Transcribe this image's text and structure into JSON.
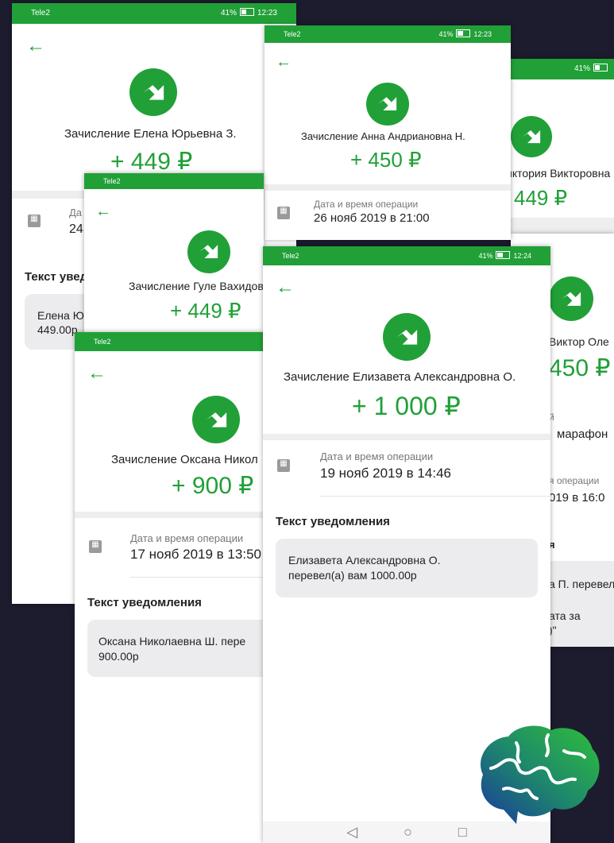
{
  "status": {
    "carrier": "Tele2",
    "battery": "41%",
    "times": [
      "12:23",
      "12:24"
    ]
  },
  "screens": {
    "s1": {
      "title": "Зачисление Елена Юрьевна З.",
      "amount": "+ 449 ₽",
      "date_label": "Да",
      "date_value": "24",
      "notif_title": "Текст увед",
      "notif_text": [
        "Елена Ю",
        "449.00р"
      ]
    },
    "s2": {
      "title": "Зачисление Анна Андриановна Н.",
      "amount": "+ 450 ₽",
      "date_label": "Дата и время операции",
      "date_value": "26 нояб 2019 в 21:00"
    },
    "s3": {
      "title": "иктория Викторовна",
      "amount": "449 ₽"
    },
    "s4": {
      "title": "Зачисление Гуле Вахидов",
      "amount": "+ 449 ₽"
    },
    "s5": {
      "title": "Зачисление Оксана Никол",
      "amount": "+ 900 ₽",
      "date_label": "Дата и время операции",
      "date_value": "17 нояб 2019 в 13:50",
      "notif_title": "Текст уведомления",
      "notif_text": [
        "Оксана Николаевна Ш. пере",
        "900.00р"
      ]
    },
    "s6": {
      "title": "Зачисление Елизавета Александровна О.",
      "amount": "+ 1 000 ₽",
      "date_label": "Дата и время операции",
      "date_value": "19 нояб 2019 в 14:46",
      "notif_title": "Текст уведомления",
      "notif_text": [
        "Елизавета Александровна О.",
        "перевел(а) вам 1000.00р"
      ]
    },
    "s7": {
      "title": "Виктор Оле",
      "amount": "450 ₽",
      "frag_a": "й",
      "frag_b": "марафон",
      "frag_c": "я операции",
      "frag_d": "019 в 16:0",
      "frag_e": "я",
      "frag_f": "а П. перевел",
      "frag_g": "ата за",
      "frag_h": ")\""
    }
  },
  "navbar": {
    "back": "◁",
    "home": "○",
    "recent": "□"
  },
  "icons": {
    "back": "arrow-left-icon",
    "logo": "bank-transfer-logo-icon",
    "calendar": "calendar-icon",
    "brain": "brain-puzzle-logo"
  },
  "colors": {
    "brand_green": "#21a038",
    "background": "#1c1c2e"
  }
}
